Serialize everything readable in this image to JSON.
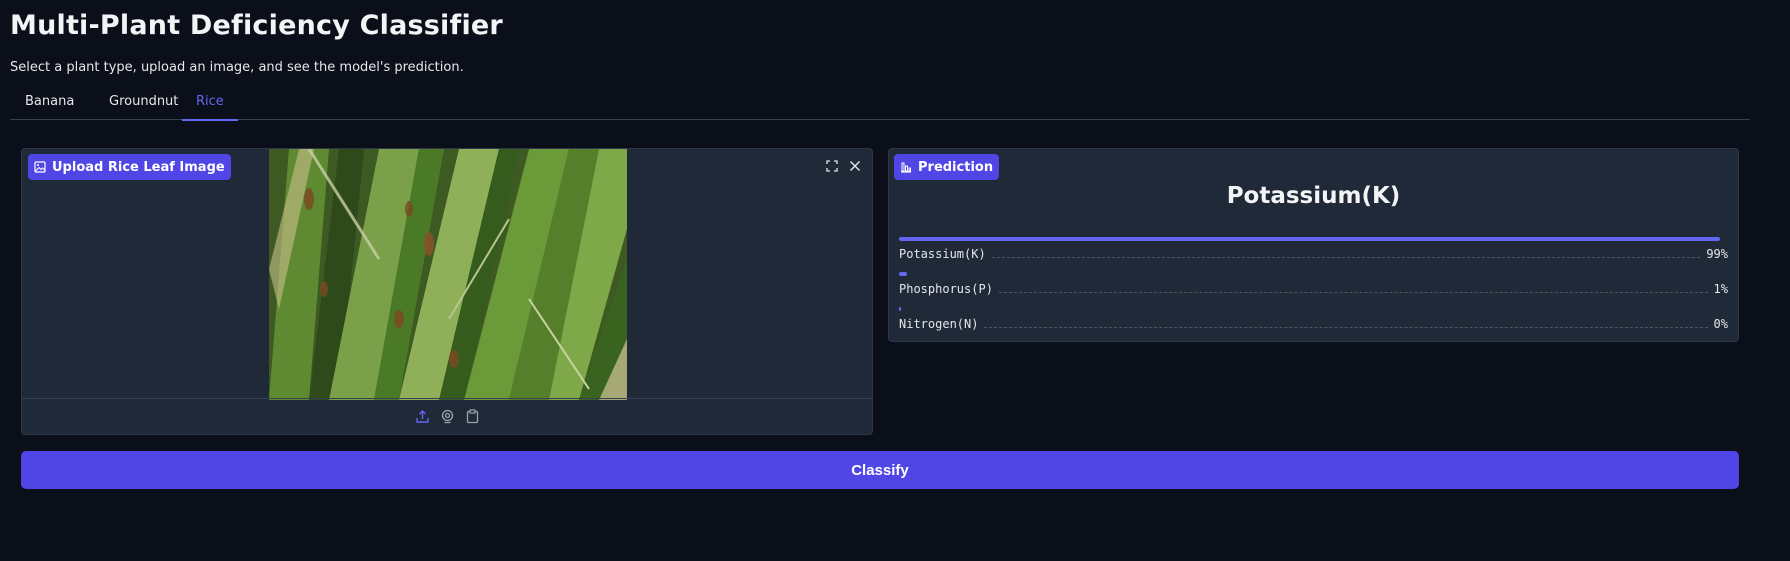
{
  "header": {
    "title": "Multi-Plant Deficiency Classifier",
    "subtitle": "Select a plant type, upload an image, and see the model's prediction."
  },
  "tabs": [
    {
      "label": "Banana",
      "selected": false
    },
    {
      "label": "Groundnut",
      "selected": false
    },
    {
      "label": "Rice",
      "selected": true
    }
  ],
  "upload": {
    "label": "Upload Rice Leaf Image",
    "image_icon": "image-icon",
    "corner_icons": [
      "fullscreen-icon",
      "close-icon"
    ],
    "footer_icons": [
      "upload-icon",
      "webcam-icon",
      "clipboard-icon"
    ]
  },
  "prediction": {
    "label": "Prediction",
    "icon": "bar-chart-icon",
    "top_class": "Potassium(K)",
    "confidences": [
      {
        "label": "Potassium(K)",
        "value": 0.99,
        "display": "99%"
      },
      {
        "label": "Phosphorus(P)",
        "value": 0.01,
        "display": "1%"
      },
      {
        "label": "Nitrogen(N)",
        "value": 0.0,
        "display": "0%"
      }
    ]
  },
  "actions": {
    "classify_label": "Classify"
  },
  "colors": {
    "background": "#0b0f19",
    "panel": "#1f2937",
    "accent": "#4f46e5",
    "accent_light": "#6366f1"
  }
}
